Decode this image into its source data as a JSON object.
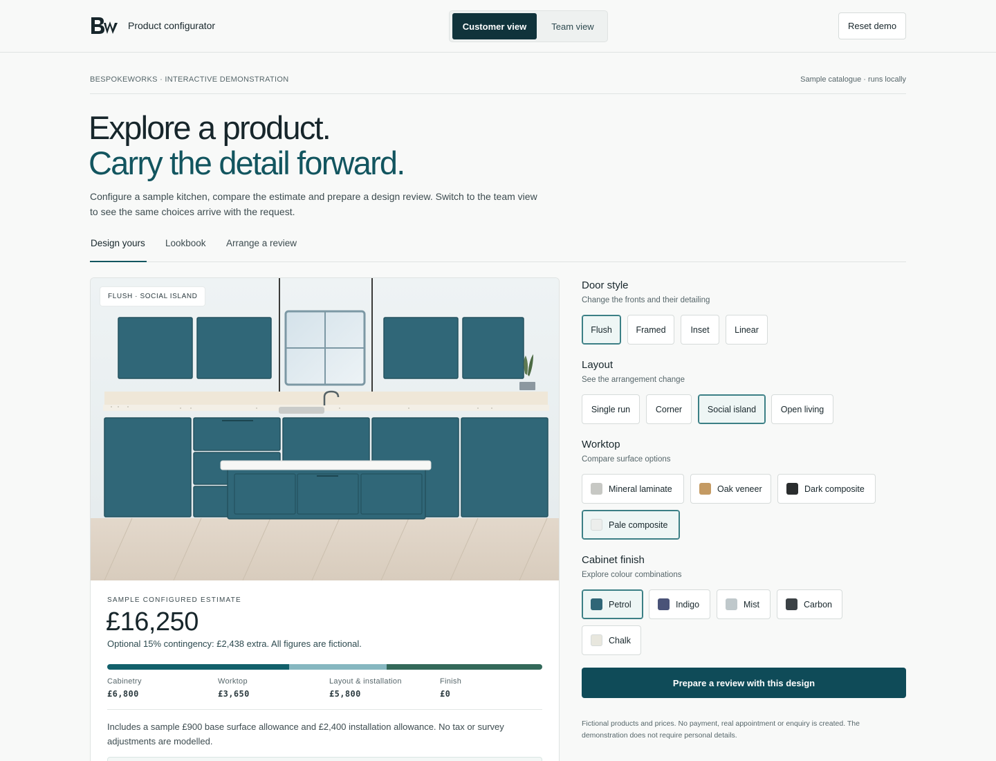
{
  "header": {
    "logo_text": "Bw",
    "title": "Product configurator",
    "views": [
      "Customer view",
      "Team view"
    ],
    "reset_label": "Reset demo"
  },
  "meta": {
    "left": "BESPOKEWORKS · INTERACTIVE DEMONSTRATION",
    "right": "Sample catalogue · runs locally"
  },
  "hero": {
    "line1": "Explore a product.",
    "line2": "Carry the detail forward.",
    "lead": "Configure a sample kitchen, compare the estimate and prepare a design review. Switch to the team view to see the same choices arrive with the request."
  },
  "tabs": [
    "Design yours",
    "Lookbook",
    "Arrange a review"
  ],
  "preview": {
    "tag": "FLUSH · SOCIAL ISLAND",
    "estimate_label": "SAMPLE CONFIGURED ESTIMATE",
    "price": "£16,250",
    "note": "Optional 15% contingency: £2,438 extra. All figures are fictional.",
    "breakdown": [
      {
        "label": "Cabinetry",
        "value": "£6,800",
        "amount": 6800,
        "color": "#12606b"
      },
      {
        "label": "Worktop",
        "value": "£3,650",
        "amount": 3650,
        "color": "#86b7c0"
      },
      {
        "label": "Layout & installation",
        "value": "£5,800",
        "amount": 5800,
        "color": "#33695a"
      },
      {
        "label": "Finish",
        "value": "£0",
        "amount": 0,
        "color": "#c9d2cf"
      }
    ],
    "footnote": "Includes a sample £900 base surface allowance and £2,400 installation allowance. No tax or survey adjustments are modelled."
  },
  "door_style": {
    "title": "Door style",
    "subtitle": "Change the fronts and their detailing",
    "options": [
      "Flush",
      "Framed",
      "Inset",
      "Linear"
    ],
    "selected": "Flush"
  },
  "layout": {
    "title": "Layout",
    "subtitle": "See the arrangement change",
    "options": [
      "Single run",
      "Corner",
      "Social island",
      "Open living"
    ],
    "selected": "Social island"
  },
  "worktop": {
    "title": "Worktop",
    "subtitle": "Compare surface options",
    "options": [
      {
        "label": "Mineral laminate",
        "color": "#c7c8c4"
      },
      {
        "label": "Oak veneer",
        "color": "#c49a63"
      },
      {
        "label": "Dark composite",
        "color": "#2a2d2e"
      },
      {
        "label": "Pale composite",
        "color": "#eceeec"
      }
    ],
    "selected": "Pale composite"
  },
  "cabinet_finish": {
    "title": "Cabinet finish",
    "subtitle": "Explore colour combinations",
    "options": [
      {
        "label": "Petrol",
        "color": "#2f6677"
      },
      {
        "label": "Indigo",
        "color": "#4a5378"
      },
      {
        "label": "Mist",
        "color": "#bfc8cb"
      },
      {
        "label": "Carbon",
        "color": "#3b4145"
      },
      {
        "label": "Chalk",
        "color": "#e8e7de"
      }
    ],
    "selected": "Petrol"
  },
  "cta_label": "Prepare a review with this design",
  "disclaimer": "Fictional products and prices. No payment, real appointment or enquiry is created. The demonstration does not require personal details.",
  "colors": {
    "accent": "#0f4b58",
    "cabinet": "#2f6677",
    "heading_accent": "#12555f"
  }
}
